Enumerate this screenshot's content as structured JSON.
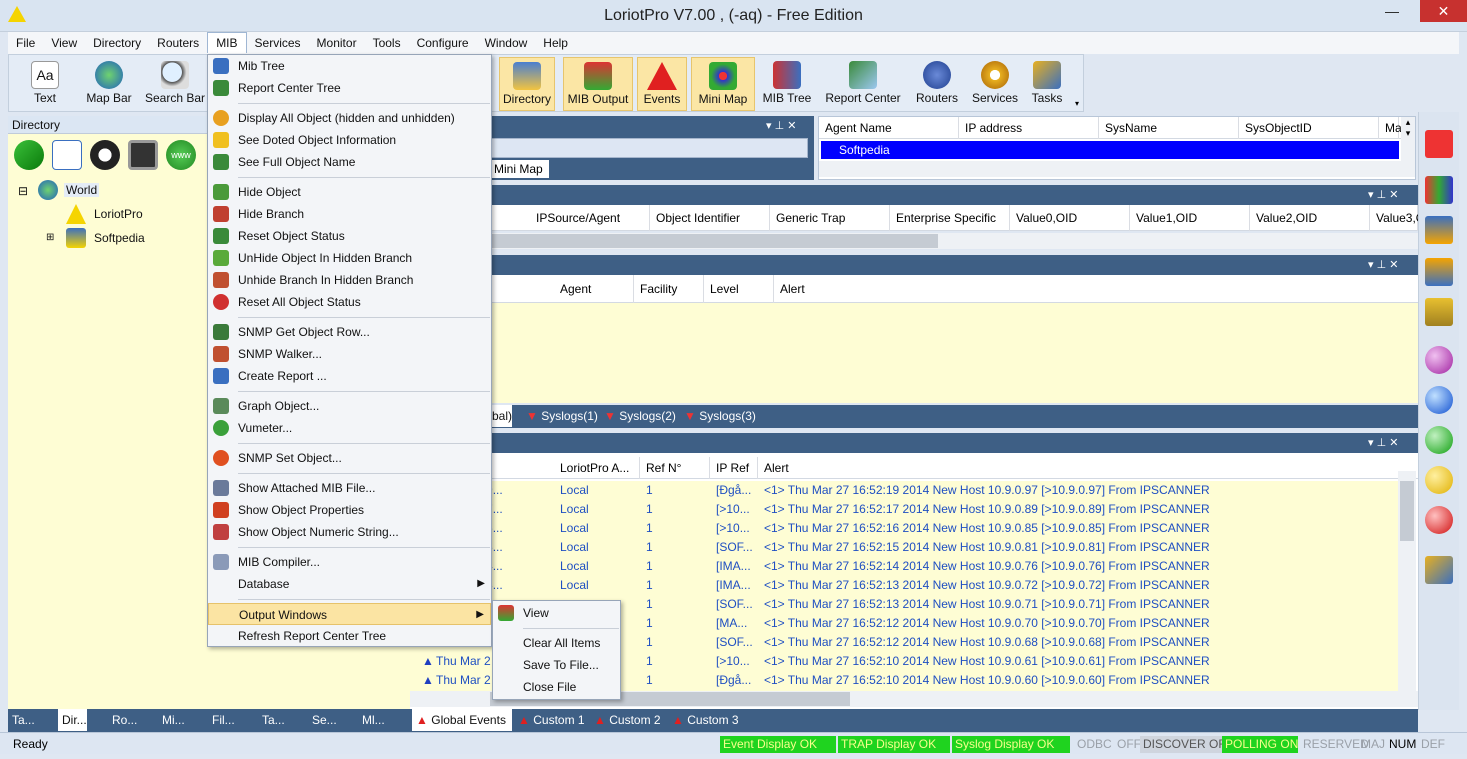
{
  "window": {
    "title": "LoriotPro V7.00 , (-aq) - Free Edition",
    "minimize": "—",
    "maximize": "☐",
    "close": "✕"
  },
  "menu": [
    "File",
    "View",
    "Directory",
    "Routers",
    "MIB",
    "Services",
    "Monitor",
    "Tools",
    "Configure",
    "Window",
    "Help"
  ],
  "toolbar": {
    "left": [
      {
        "label": "Text",
        "icon": "text-icon"
      },
      {
        "label": "Map Bar",
        "icon": "globe-icon"
      },
      {
        "label": "Search Bar",
        "icon": "magnifier-icon"
      }
    ],
    "right": [
      {
        "label": "Directory",
        "icon": "directory-tree-icon"
      },
      {
        "label": "MIB Output",
        "icon": "mib-output-icon"
      },
      {
        "label": "Events",
        "icon": "warning-icon"
      },
      {
        "label": "Mini Map",
        "icon": "network-map-icon"
      },
      {
        "label": "MIB Tree",
        "icon": "mib-tree-icon"
      },
      {
        "label": "Report Center",
        "icon": "report-center-icon"
      },
      {
        "label": "Routers",
        "icon": "router-icon"
      },
      {
        "label": "Services",
        "icon": "gear-icon"
      },
      {
        "label": "Tasks",
        "icon": "tasks-icon"
      }
    ]
  },
  "directory": {
    "title": "Directory",
    "tree": [
      {
        "label": "World",
        "icon": "globe-icon"
      },
      {
        "label": "LoriotPro",
        "icon": "warning-icon"
      },
      {
        "label": "Softpedia",
        "icon": "network-icon"
      }
    ]
  },
  "mib_menu": {
    "items": [
      {
        "label": "Mib Tree"
      },
      {
        "label": "Report  Center Tree"
      },
      {
        "label": "Display All Object (hidden and unhidden)"
      },
      {
        "label": "See Doted Object  Information"
      },
      {
        "label": "See Full Object Name"
      },
      {
        "label": "Hide Object"
      },
      {
        "label": "Hide Branch"
      },
      {
        "label": "Reset Object Status"
      },
      {
        "label": "UnHide Object In Hidden Branch"
      },
      {
        "label": "Unhide Branch In Hidden Branch"
      },
      {
        "label": "Reset All Object Status"
      },
      {
        "label": "SNMP Get Object Row..."
      },
      {
        "label": "SNMP Walker..."
      },
      {
        "label": "Create Report ..."
      },
      {
        "label": "Graph Object..."
      },
      {
        "label": "Vumeter..."
      },
      {
        "label": "SNMP Set Object..."
      },
      {
        "label": "Show Attached MIB File..."
      },
      {
        "label": "Show Object Properties"
      },
      {
        "label": "Show Object Numeric String..."
      },
      {
        "label": "MIB Compiler..."
      },
      {
        "label": "Database"
      },
      {
        "label": "Output Windows"
      },
      {
        "label": "Refresh Report Center Tree"
      }
    ]
  },
  "output_submenu": [
    "View",
    "Clear All Items",
    "Save To File...",
    "Close File"
  ],
  "agent_table": {
    "headers": [
      "Agent Name",
      "IP address",
      "SysName",
      "SysObjectID",
      "Ma"
    ],
    "rows": [
      [
        "Softpedia"
      ]
    ]
  },
  "mini_map_tab": "Mini Map",
  "trap_table": {
    "headers": [
      "IPSource/Agent",
      "Object Identifier",
      "Generic Trap",
      "Enterprise Specific",
      "Value0,OID",
      "Value1,OID",
      "Value2,OID",
      "Value3,O"
    ]
  },
  "syslog_table": {
    "headers": [
      "Agent",
      "Facility",
      "Level",
      "Alert"
    ]
  },
  "syslog_tabs": [
    "bal)",
    "Syslogs(1)",
    "Syslogs(2)",
    "Syslogs(3)"
  ],
  "events_table": {
    "headers": [
      "LoriotPro A...",
      "Ref N°",
      "IP Ref",
      "Alert"
    ],
    "rows": [
      [
        "7 16:52:19...",
        "Local",
        "1",
        "[Đgå...",
        "<1> Thu Mar 27 16:52:19 2014 New Host 10.9.0.97 [>10.9.0.97] From IPSCANNER"
      ],
      [
        "7 16:52:17...",
        "Local",
        "1",
        "[>10...",
        "<1> Thu Mar 27 16:52:17 2014 New Host 10.9.0.89 [>10.9.0.89] From IPSCANNER"
      ],
      [
        "7 16:52:16...",
        "Local",
        "1",
        "[>10...",
        "<1> Thu Mar 27 16:52:16 2014 New Host 10.9.0.85 [>10.9.0.85] From IPSCANNER"
      ],
      [
        "7 16:52:15...",
        "Local",
        "1",
        "[SOF...",
        "<1> Thu Mar 27 16:52:15 2014 New Host 10.9.0.81 [>10.9.0.81] From IPSCANNER"
      ],
      [
        "7 16:52:14...",
        "Local",
        "1",
        "[IMA...",
        "<1> Thu Mar 27 16:52:14 2014 New Host 10.9.0.76 [>10.9.0.76] From IPSCANNER"
      ],
      [
        "7 16:52:13...",
        "Local",
        "1",
        "[IMA...",
        "<1> Thu Mar 27 16:52:13 2014 New Host 10.9.0.72 [>10.9.0.72] From IPSCANNER"
      ],
      [
        "",
        "",
        "1",
        "[SOF...",
        "<1> Thu Mar 27 16:52:13 2014 New Host 10.9.0.71 [>10.9.0.71] From IPSCANNER"
      ],
      [
        "",
        "",
        "1",
        "[MA...",
        "<1> Thu Mar 27 16:52:12 2014 New Host 10.9.0.70 [>10.9.0.70] From IPSCANNER"
      ],
      [
        "",
        "",
        "1",
        "[SOF...",
        "<1> Thu Mar 27 16:52:12 2014 New Host 10.9.0.68 [>10.9.0.68] From IPSCANNER"
      ],
      [
        "Thu Mar 2",
        "",
        "1",
        "[>10...",
        "<1> Thu Mar 27 16:52:10 2014 New Host 10.9.0.61 [>10.9.0.61] From IPSCANNER"
      ],
      [
        "Thu Mar 2",
        "",
        "1",
        "[Đgå...",
        "<1> Thu Mar 27 16:52:10 2014 New Host 10.9.0.60 [>10.9.0.60] From IPSCANNER"
      ]
    ]
  },
  "event_tabs": [
    "Global Events",
    "Custom 1",
    "Custom 2",
    "Custom 3"
  ],
  "left_tabs": [
    "Ta...",
    "Dir...",
    "Ro...",
    "Mi...",
    "Fil...",
    "Ta...",
    "Se...",
    "Ml..."
  ],
  "status": {
    "ready": "Ready",
    "items": [
      "Event Display OK",
      "TRAP Display OK",
      "Syslog Display OK",
      "ODBC",
      "OFF",
      "DISCOVER OFF",
      "POLLING ON",
      "RESERVED",
      "MAJ",
      "NUM",
      "DEF"
    ]
  },
  "colors": {
    "selection_blue": "#0000ff",
    "panel_header": "#3e5f85",
    "yellow_bg": "#fefdd4",
    "highlight": "#fbe4a3",
    "status_green": "#1fd31f"
  }
}
